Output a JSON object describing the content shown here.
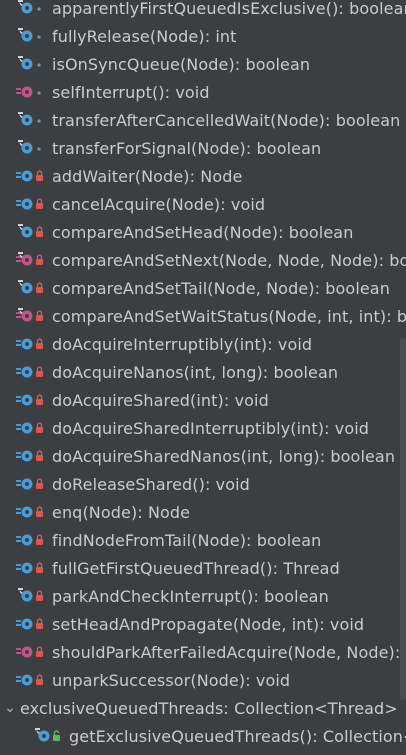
{
  "methods": [
    {
      "label": "apparentlyFirstQueuedIsExclusive(): boolean",
      "kind": "final",
      "access": "dot"
    },
    {
      "label": "fullyRelease(Node): int",
      "kind": "final",
      "access": "dot"
    },
    {
      "label": "isOnSyncQueue(Node): boolean",
      "kind": "final",
      "access": "dot"
    },
    {
      "label": "selfInterrupt(): void",
      "kind": "static",
      "access": "dot"
    },
    {
      "label": "transferAfterCancelledWait(Node): boolean",
      "kind": "final",
      "access": "dot"
    },
    {
      "label": "transferForSignal(Node): boolean",
      "kind": "final",
      "access": "dot"
    },
    {
      "label": "addWaiter(Node): Node",
      "kind": "plain",
      "access": "lock"
    },
    {
      "label": "cancelAcquire(Node): void",
      "kind": "plain",
      "access": "lock"
    },
    {
      "label": "compareAndSetHead(Node): boolean",
      "kind": "final",
      "access": "lock"
    },
    {
      "label": "compareAndSetNext(Node, Node, Node): boolean",
      "kind": "static-final",
      "access": "lock"
    },
    {
      "label": "compareAndSetTail(Node, Node): boolean",
      "kind": "final",
      "access": "lock"
    },
    {
      "label": "compareAndSetWaitStatus(Node, int, int): boolean",
      "kind": "static-final",
      "access": "lock"
    },
    {
      "label": "doAcquireInterruptibly(int): void",
      "kind": "plain",
      "access": "lock"
    },
    {
      "label": "doAcquireNanos(int, long): boolean",
      "kind": "plain",
      "access": "lock"
    },
    {
      "label": "doAcquireShared(int): void",
      "kind": "plain",
      "access": "lock"
    },
    {
      "label": "doAcquireSharedInterruptibly(int): void",
      "kind": "plain",
      "access": "lock"
    },
    {
      "label": "doAcquireSharedNanos(int, long): boolean",
      "kind": "plain",
      "access": "lock"
    },
    {
      "label": "doReleaseShared(): void",
      "kind": "plain",
      "access": "lock"
    },
    {
      "label": "enq(Node): Node",
      "kind": "plain",
      "access": "lock"
    },
    {
      "label": "findNodeFromTail(Node): boolean",
      "kind": "plain",
      "access": "lock"
    },
    {
      "label": "fullGetFirstQueuedThread(): Thread",
      "kind": "plain",
      "access": "lock"
    },
    {
      "label": "parkAndCheckInterrupt(): boolean",
      "kind": "final",
      "access": "lock"
    },
    {
      "label": "setHeadAndPropagate(Node, int): void",
      "kind": "plain",
      "access": "lock"
    },
    {
      "label": "shouldParkAfterFailedAcquire(Node, Node): boolean",
      "kind": "static",
      "access": "lock"
    },
    {
      "label": "unparkSuccessor(Node): void",
      "kind": "plain",
      "access": "lock"
    }
  ],
  "group": {
    "label": "exclusiveQueuedThreads: Collection<Thread>",
    "expander": "⌄",
    "children": [
      {
        "label": "getExclusiveQueuedThreads(): Collection<Thread>",
        "kind": "final",
        "access": "public"
      }
    ]
  },
  "colors": {
    "background": "#3c3f41",
    "method_icon": "#4a9cd6",
    "static_icon": "#c2528a",
    "lock": "#d9574f",
    "public": "#5fb85a",
    "text": "#c9cccf"
  }
}
